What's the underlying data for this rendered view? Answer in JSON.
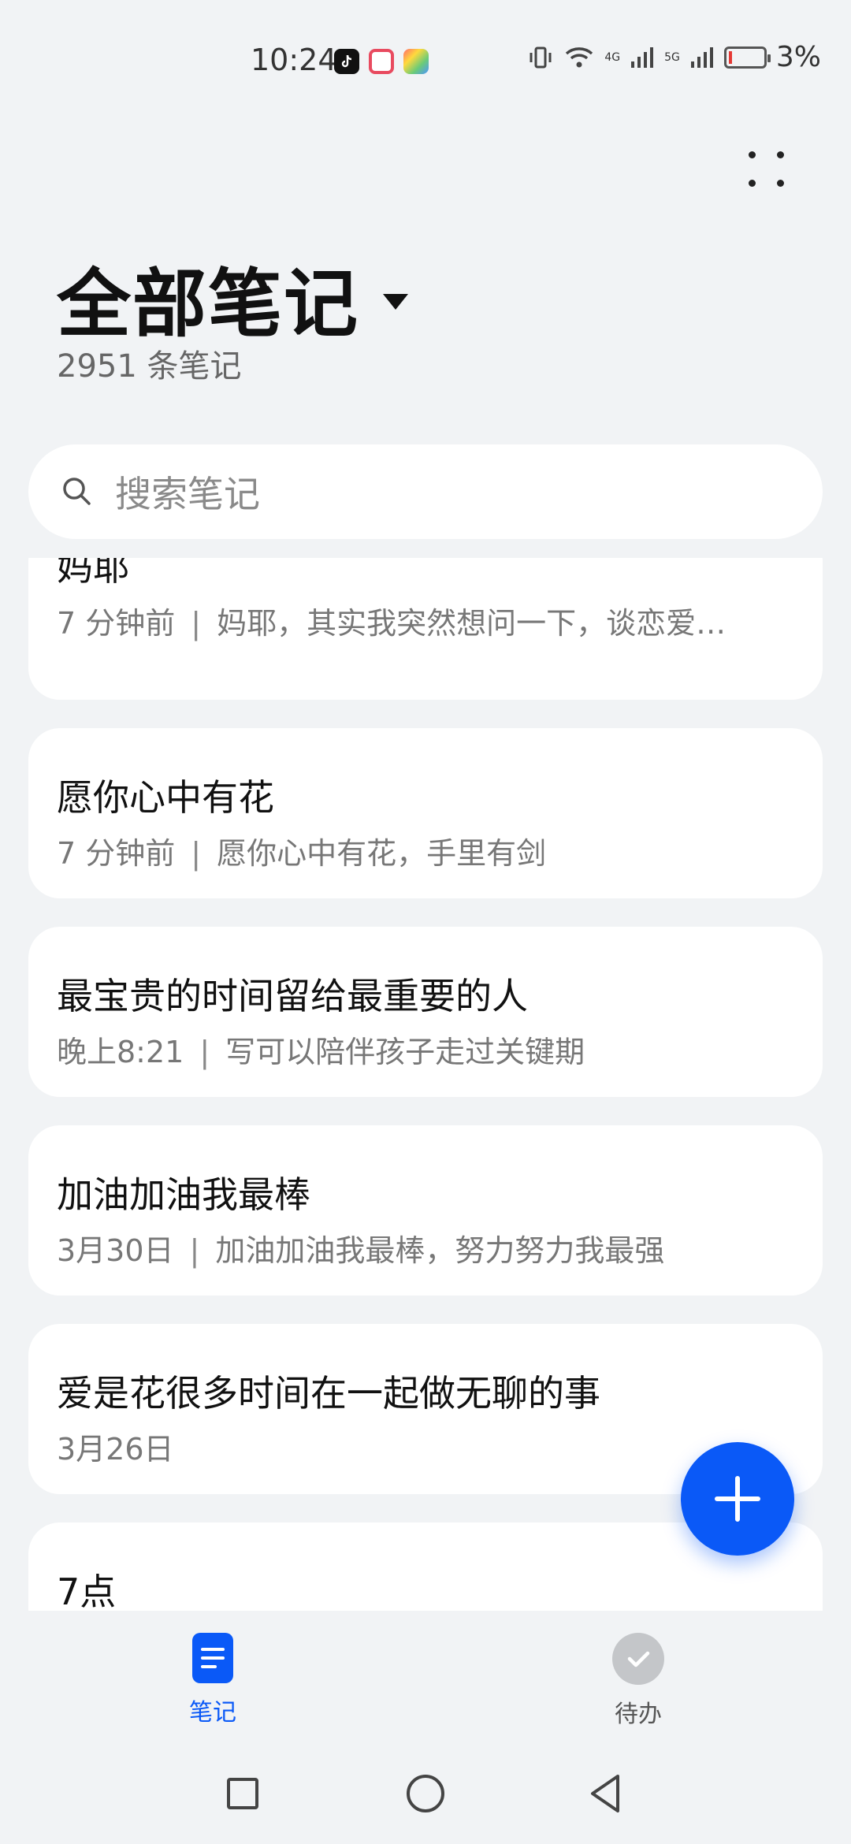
{
  "status_bar": {
    "time": "10:24",
    "network_a": "4G",
    "network_b": "5G",
    "battery": "3%"
  },
  "header": {
    "title": "全部笔记",
    "count": "2951 条笔记"
  },
  "search": {
    "placeholder": "搜索笔记"
  },
  "notes": [
    {
      "title": "妈耶",
      "time": "7 分钟前",
      "preview": "妈耶，其实我突然想问一下，谈恋爱…"
    },
    {
      "title": "愿你心中有花",
      "time": "7 分钟前",
      "preview": "愿你心中有花，手里有剑"
    },
    {
      "title": "最宝贵的时间留给最重要的人",
      "time": "晚上8:21",
      "preview": "写可以陪伴孩子走过关键期"
    },
    {
      "title": "加油加油我最棒",
      "time": "3月30日",
      "preview": "加油加油我最棒，努力努力我最强"
    },
    {
      "title": "爱是花很多时间在一起做无聊的事",
      "time": "3月26日",
      "preview": ""
    },
    {
      "title": "7点",
      "time": "",
      "preview": ""
    }
  ],
  "tabs": {
    "notes": "笔记",
    "todo": "待办"
  },
  "colors": {
    "accent": "#0a59f7",
    "background": "#f1f3f5",
    "card": "#ffffff"
  }
}
